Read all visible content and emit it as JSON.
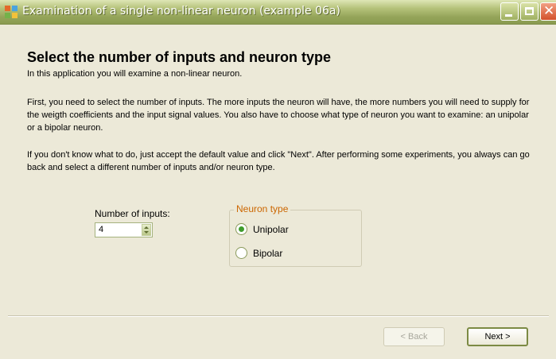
{
  "window": {
    "title": "Examination of a single non-linear neuron (example 06a)",
    "icons": [
      "app-icon",
      "minimize-icon",
      "maximize-icon",
      "close-icon"
    ]
  },
  "content": {
    "heading": "Select the number of inputs and neuron type",
    "intro": "In this application you will examine a non-linear neuron.",
    "paragraph1": "First, you need to select the number of inputs. The more inputs the neuron will have, the more numbers you will need to supply for the weigth coefficients and the input signal values. You also have to choose what type of neuron you want to examine: an unipolar or a bipolar neuron.",
    "paragraph2": "If you don't know what to do, just accept the default value and click \"Next\". After performing some experiments, you always can go back and select a different number of inputs and/or neuron type."
  },
  "inputs": {
    "label": "Number of inputs:",
    "value": "4"
  },
  "neuron_type": {
    "legend": "Neuron type",
    "options": [
      {
        "label": "Unipolar",
        "selected": true
      },
      {
        "label": "Bipolar",
        "selected": false
      }
    ]
  },
  "buttons": {
    "back": "< Back",
    "next": "Next >"
  },
  "colors": {
    "title_bar": "#95a55a",
    "group_legend": "#cc6600",
    "radio_selected": "#3e9c2c",
    "window_bg": "#ece9d8"
  }
}
